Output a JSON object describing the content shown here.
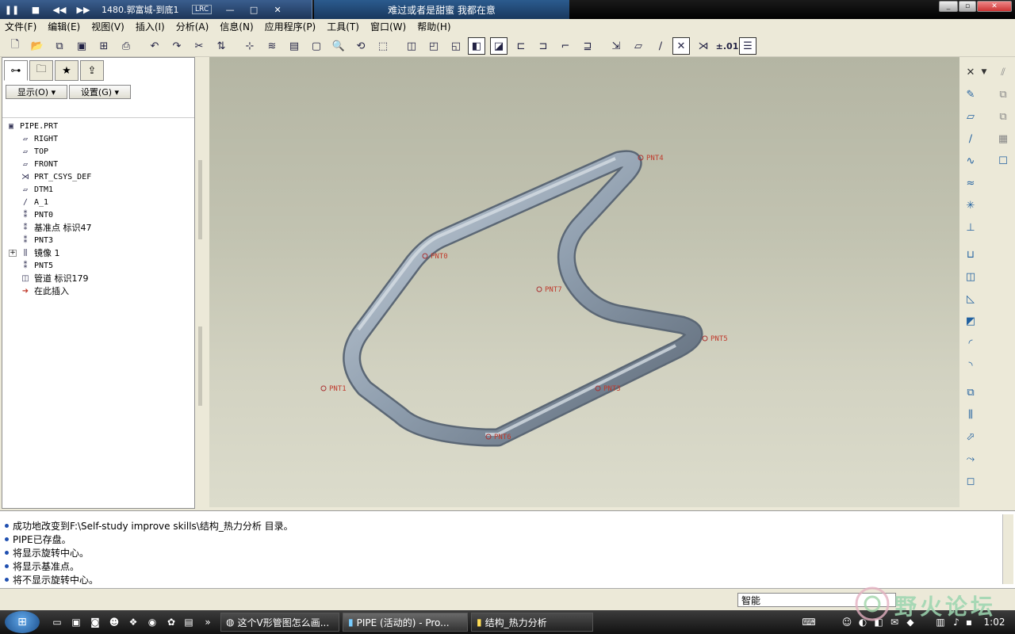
{
  "player": {
    "track": "1480.郭富城-到底1",
    "lrc_label": "LRC",
    "lyric": "难过或者是甜蜜 我都在意"
  },
  "menu": [
    "文件(F)",
    "编辑(E)",
    "视图(V)",
    "插入(I)",
    "分析(A)",
    "信息(N)",
    "应用程序(P)",
    "工具(T)",
    "窗口(W)",
    "帮助(H)"
  ],
  "toolbar": {
    "precision_label": "±.01"
  },
  "left_panel": {
    "show_label": "显示(O) ▾",
    "settings_label": "设置(G) ▾",
    "tree": [
      {
        "label": "PIPE.PRT",
        "icon": "part-icon"
      },
      {
        "label": "RIGHT",
        "icon": "datum-plane-icon"
      },
      {
        "label": "TOP",
        "icon": "datum-plane-icon"
      },
      {
        "label": "FRONT",
        "icon": "datum-plane-icon"
      },
      {
        "label": "PRT_CSYS_DEF",
        "icon": "csys-icon"
      },
      {
        "label": "DTM1",
        "icon": "datum-plane-icon"
      },
      {
        "label": "A_1",
        "icon": "datum-axis-icon"
      },
      {
        "label": "PNT0",
        "icon": "datum-point-icon"
      },
      {
        "label": "基准点 标识47",
        "icon": "datum-point-icon"
      },
      {
        "label": "PNT3",
        "icon": "datum-point-icon"
      },
      {
        "label": "镜像 1",
        "icon": "mirror-icon"
      },
      {
        "label": "PNT5",
        "icon": "datum-point-icon"
      },
      {
        "label": "管道 标识179",
        "icon": "pipe-icon"
      },
      {
        "label": "在此插入",
        "icon": "insert-here-icon"
      }
    ]
  },
  "viewport": {
    "points": [
      "PNT4",
      "PNT0",
      "PNT7",
      "PNT5",
      "PNT1",
      "PNT3",
      "PNT6"
    ]
  },
  "messages": [
    "成功地改变到F:\\Self-study improve skills\\结构_热力分析 目录。",
    "PIPE已存盘。",
    "将显示旋转中心。",
    "将显示基准点。",
    "将不显示旋转中心。"
  ],
  "status": {
    "filter": "智能"
  },
  "taskbar": {
    "tasks": [
      "这个V形管图怎么画...",
      "PIPE (活动的) - Pro...",
      "结构_热力分析"
    ],
    "clock": "1:02"
  },
  "watermark": "野火论坛"
}
